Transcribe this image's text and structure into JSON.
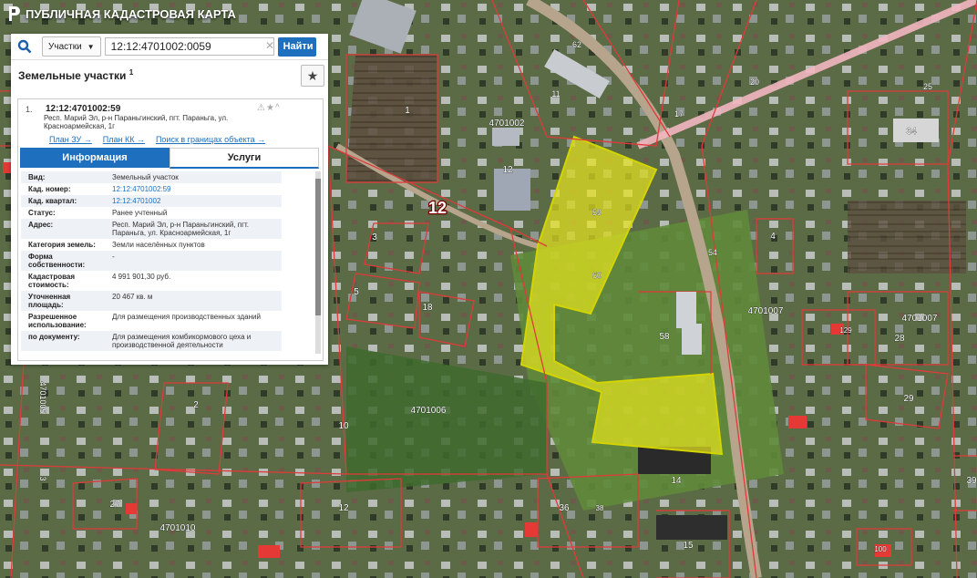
{
  "app": {
    "title": "ПУБЛИЧНАЯ КАДАСТРОВАЯ КАРТА"
  },
  "search": {
    "type_label": "Участки",
    "query": "12:12:4701002:0059",
    "button": "Найти"
  },
  "results": {
    "title": "Земельные участки",
    "count": "1"
  },
  "card": {
    "index": "1.",
    "cad_number": "12:12:4701002:59",
    "address": "Респ. Марий Эл, р-н Параньгинский, пгт. Параньга, ул. Красноармейская, 1г",
    "links": [
      "План ЗУ →",
      "План КК →",
      "Поиск в границах объекта →"
    ],
    "tabs": [
      "Информация",
      "Услуги"
    ],
    "rows": [
      {
        "k": "Вид:",
        "v": "Земельный участок"
      },
      {
        "k": "Кад. номер:",
        "v": "12:12:4701002:59",
        "link": true
      },
      {
        "k": "Кад. квартал:",
        "v": "12:12:4701002",
        "link": true
      },
      {
        "k": "Статус:",
        "v": "Ранее учтенный"
      },
      {
        "k": "Адрес:",
        "v": "Респ. Марий Эл, р-н Параньгинский, пгт. Параньга, ул. Красноармейская, 1г"
      },
      {
        "k": "Категория земель:",
        "v": "Земли населённых пунктов"
      },
      {
        "k": "Форма собственности:",
        "v": "-"
      },
      {
        "k": "Кадастровая стоимость:",
        "v": "4 991 901,30 руб."
      },
      {
        "k": "Уточненная площадь:",
        "v": "20 467 кв. м"
      },
      {
        "k": "Разрешенное использование:",
        "v": "Для размещения производственных зданий"
      },
      {
        "k": "по документу:",
        "v": "Для размещения комбикормового цеха и производственной деятельности"
      }
    ]
  },
  "map_labels": [
    {
      "t": "62"
    },
    {
      "t": "20"
    },
    {
      "t": "17"
    },
    {
      "t": "25"
    },
    {
      "t": "11"
    },
    {
      "t": "4701002"
    },
    {
      "t": "12"
    },
    {
      "t": "12"
    },
    {
      "t": "59"
    },
    {
      "t": "60"
    },
    {
      "t": "34"
    },
    {
      "t": "1"
    },
    {
      "t": "3"
    },
    {
      "t": "5"
    },
    {
      "t": "18"
    },
    {
      "t": "4"
    },
    {
      "t": "4701007"
    },
    {
      "t": "4701007"
    },
    {
      "t": "28"
    },
    {
      "t": "29"
    },
    {
      "t": "58"
    },
    {
      "t": "4701006"
    },
    {
      "t": "10"
    },
    {
      "t": "2"
    },
    {
      "t": "14"
    },
    {
      "t": "36"
    },
    {
      "t": "38"
    },
    {
      "t": "12"
    },
    {
      "t": "27"
    },
    {
      "t": "4701010"
    },
    {
      "t": "15"
    },
    {
      "t": "100"
    },
    {
      "t": "39"
    },
    {
      "t": "4701005"
    },
    {
      "t": "3"
    },
    {
      "t": "54"
    },
    {
      "t": "129"
    }
  ]
}
